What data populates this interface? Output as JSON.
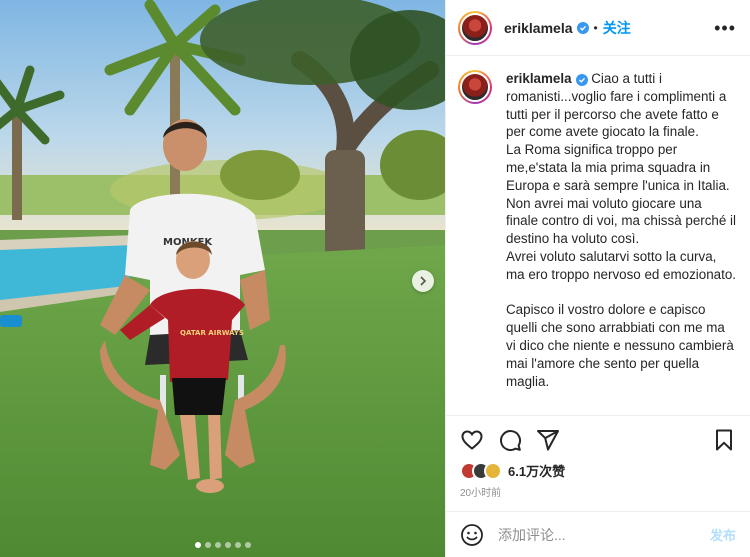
{
  "header": {
    "username": "eriklamela",
    "separator": "•",
    "follow_label": "关注",
    "more_label": "•••"
  },
  "caption": {
    "username": "eriklamela",
    "text": " Ciao a tutti i romanisti...voglio fare i complimenti a tutti per il percorso che avete fatto e per come avete giocato la finale.\nLa Roma significa troppo per me,e'stata la mia prima squadra in Europa e sarà sempre l'unica in Italia.\nNon avrei mai voluto giocare una finale contro di voi, ma chissà perché il destino ha voluto così.\nAvrei voluto salutarvi sotto la curva, ma ero troppo nervoso ed emozionato.\n\nCapisco il vostro dolore e capisco quelli che sono arrabbiati con me ma vi dico che niente e nessuno cambierà mai l'amore che sento per quella maglia."
  },
  "media": {
    "shirt_text": "MONKEK",
    "jersey_sponsor": "QATAR AIRWAYS",
    "carousel_count": 6,
    "carousel_active": 0
  },
  "engagement": {
    "likes": "6.1万次赞",
    "time": "20小时前"
  },
  "comment": {
    "placeholder": "添加评论...",
    "post_label": "发布"
  },
  "colors": {
    "accent": "#0095f6",
    "verified": "#3897f0",
    "text": "#262626",
    "muted": "#8e8e8e"
  },
  "icons": [
    "heart-icon",
    "comment-icon",
    "share-icon",
    "bookmark-icon",
    "emoji-icon",
    "verified-icon",
    "chevron-right-icon",
    "more-icon"
  ]
}
